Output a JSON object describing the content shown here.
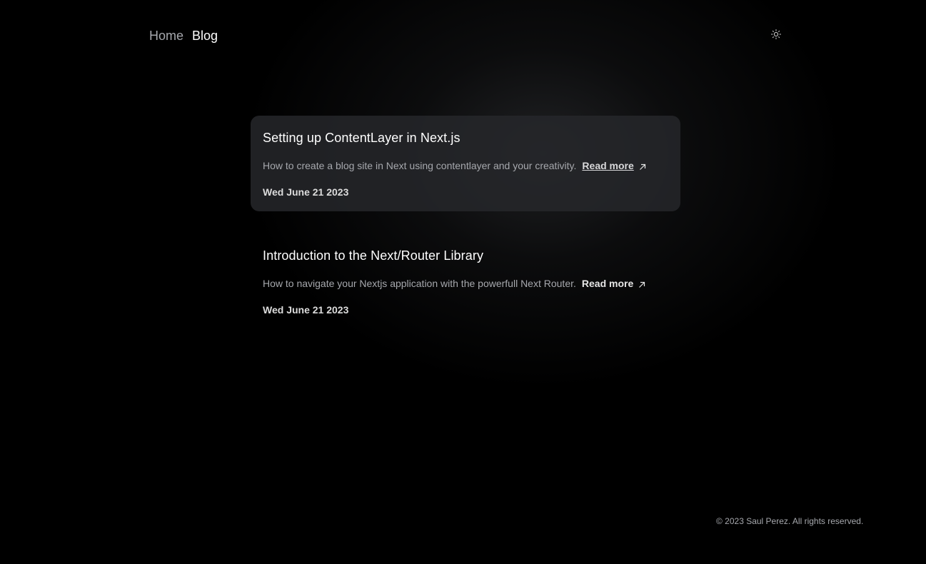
{
  "nav": {
    "home_label": "Home",
    "blog_label": "Blog"
  },
  "theme_toggle": {
    "icon": "sun-icon"
  },
  "posts": [
    {
      "title": "Setting up ContentLayer in Next.js",
      "description": "How to create a blog site in Next using contentlayer and your creativity.",
      "read_more": "Read more",
      "date": "Wed June 21 2023"
    },
    {
      "title": "Introduction to the Next/Router Library",
      "description": "How to navigate your Nextjs application with the powerfull Next Router.",
      "read_more": "Read more",
      "date": "Wed June 21 2023"
    }
  ],
  "footer": {
    "text": "© 2023 Saul Perez. All rights reserved."
  },
  "colors": {
    "background": "#000000",
    "text_primary": "#ffffff",
    "text_muted": "#a6a8ad",
    "card_hover": "#26272a"
  }
}
